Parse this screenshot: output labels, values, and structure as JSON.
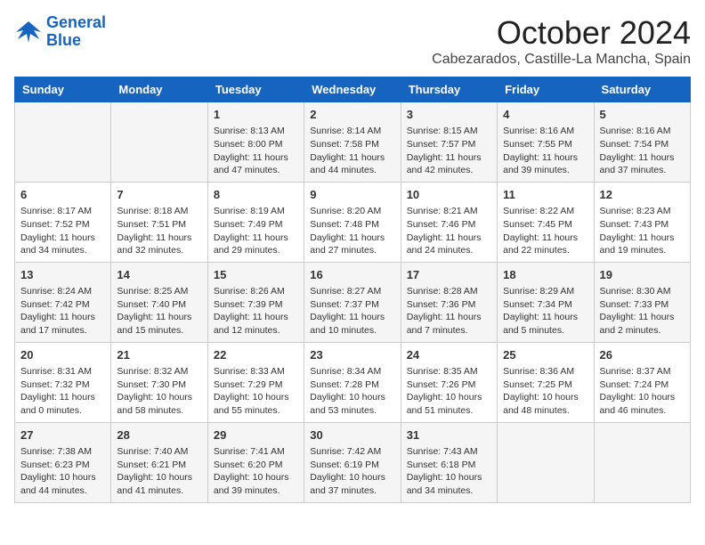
{
  "header": {
    "logo_line1": "General",
    "logo_line2": "Blue",
    "month": "October 2024",
    "location": "Cabezarados, Castille-La Mancha, Spain"
  },
  "days_of_week": [
    "Sunday",
    "Monday",
    "Tuesday",
    "Wednesday",
    "Thursday",
    "Friday",
    "Saturday"
  ],
  "weeks": [
    [
      {
        "day": "",
        "info": ""
      },
      {
        "day": "",
        "info": ""
      },
      {
        "day": "1",
        "info": "Sunrise: 8:13 AM\nSunset: 8:00 PM\nDaylight: 11 hours and 47 minutes."
      },
      {
        "day": "2",
        "info": "Sunrise: 8:14 AM\nSunset: 7:58 PM\nDaylight: 11 hours and 44 minutes."
      },
      {
        "day": "3",
        "info": "Sunrise: 8:15 AM\nSunset: 7:57 PM\nDaylight: 11 hours and 42 minutes."
      },
      {
        "day": "4",
        "info": "Sunrise: 8:16 AM\nSunset: 7:55 PM\nDaylight: 11 hours and 39 minutes."
      },
      {
        "day": "5",
        "info": "Sunrise: 8:16 AM\nSunset: 7:54 PM\nDaylight: 11 hours and 37 minutes."
      }
    ],
    [
      {
        "day": "6",
        "info": "Sunrise: 8:17 AM\nSunset: 7:52 PM\nDaylight: 11 hours and 34 minutes."
      },
      {
        "day": "7",
        "info": "Sunrise: 8:18 AM\nSunset: 7:51 PM\nDaylight: 11 hours and 32 minutes."
      },
      {
        "day": "8",
        "info": "Sunrise: 8:19 AM\nSunset: 7:49 PM\nDaylight: 11 hours and 29 minutes."
      },
      {
        "day": "9",
        "info": "Sunrise: 8:20 AM\nSunset: 7:48 PM\nDaylight: 11 hours and 27 minutes."
      },
      {
        "day": "10",
        "info": "Sunrise: 8:21 AM\nSunset: 7:46 PM\nDaylight: 11 hours and 24 minutes."
      },
      {
        "day": "11",
        "info": "Sunrise: 8:22 AM\nSunset: 7:45 PM\nDaylight: 11 hours and 22 minutes."
      },
      {
        "day": "12",
        "info": "Sunrise: 8:23 AM\nSunset: 7:43 PM\nDaylight: 11 hours and 19 minutes."
      }
    ],
    [
      {
        "day": "13",
        "info": "Sunrise: 8:24 AM\nSunset: 7:42 PM\nDaylight: 11 hours and 17 minutes."
      },
      {
        "day": "14",
        "info": "Sunrise: 8:25 AM\nSunset: 7:40 PM\nDaylight: 11 hours and 15 minutes."
      },
      {
        "day": "15",
        "info": "Sunrise: 8:26 AM\nSunset: 7:39 PM\nDaylight: 11 hours and 12 minutes."
      },
      {
        "day": "16",
        "info": "Sunrise: 8:27 AM\nSunset: 7:37 PM\nDaylight: 11 hours and 10 minutes."
      },
      {
        "day": "17",
        "info": "Sunrise: 8:28 AM\nSunset: 7:36 PM\nDaylight: 11 hours and 7 minutes."
      },
      {
        "day": "18",
        "info": "Sunrise: 8:29 AM\nSunset: 7:34 PM\nDaylight: 11 hours and 5 minutes."
      },
      {
        "day": "19",
        "info": "Sunrise: 8:30 AM\nSunset: 7:33 PM\nDaylight: 11 hours and 2 minutes."
      }
    ],
    [
      {
        "day": "20",
        "info": "Sunrise: 8:31 AM\nSunset: 7:32 PM\nDaylight: 11 hours and 0 minutes."
      },
      {
        "day": "21",
        "info": "Sunrise: 8:32 AM\nSunset: 7:30 PM\nDaylight: 10 hours and 58 minutes."
      },
      {
        "day": "22",
        "info": "Sunrise: 8:33 AM\nSunset: 7:29 PM\nDaylight: 10 hours and 55 minutes."
      },
      {
        "day": "23",
        "info": "Sunrise: 8:34 AM\nSunset: 7:28 PM\nDaylight: 10 hours and 53 minutes."
      },
      {
        "day": "24",
        "info": "Sunrise: 8:35 AM\nSunset: 7:26 PM\nDaylight: 10 hours and 51 minutes."
      },
      {
        "day": "25",
        "info": "Sunrise: 8:36 AM\nSunset: 7:25 PM\nDaylight: 10 hours and 48 minutes."
      },
      {
        "day": "26",
        "info": "Sunrise: 8:37 AM\nSunset: 7:24 PM\nDaylight: 10 hours and 46 minutes."
      }
    ],
    [
      {
        "day": "27",
        "info": "Sunrise: 7:38 AM\nSunset: 6:23 PM\nDaylight: 10 hours and 44 minutes."
      },
      {
        "day": "28",
        "info": "Sunrise: 7:40 AM\nSunset: 6:21 PM\nDaylight: 10 hours and 41 minutes."
      },
      {
        "day": "29",
        "info": "Sunrise: 7:41 AM\nSunset: 6:20 PM\nDaylight: 10 hours and 39 minutes."
      },
      {
        "day": "30",
        "info": "Sunrise: 7:42 AM\nSunset: 6:19 PM\nDaylight: 10 hours and 37 minutes."
      },
      {
        "day": "31",
        "info": "Sunrise: 7:43 AM\nSunset: 6:18 PM\nDaylight: 10 hours and 34 minutes."
      },
      {
        "day": "",
        "info": ""
      },
      {
        "day": "",
        "info": ""
      }
    ]
  ]
}
